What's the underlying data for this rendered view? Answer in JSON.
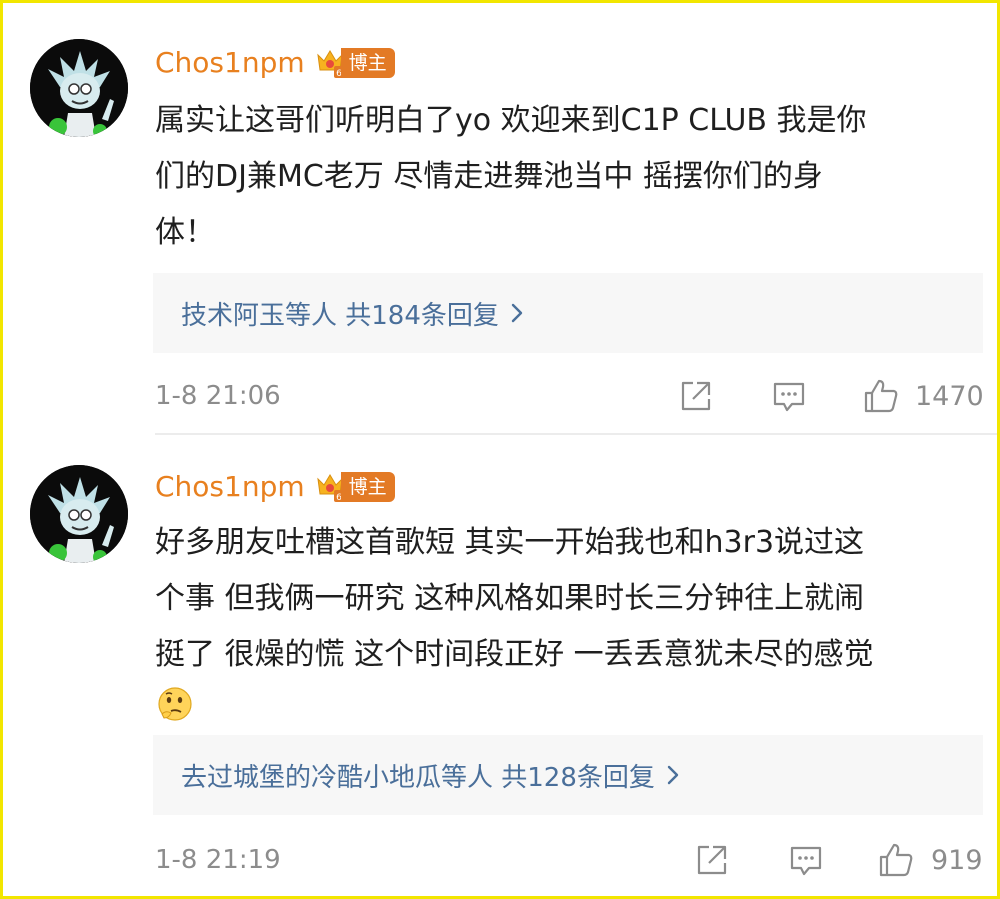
{
  "comments": [
    {
      "username": "Chos1npm",
      "badge_label": "博主",
      "text": "属实让这哥们听明白了yo 欢迎来到C1P CLUB 我是你\n们的DJ兼MC老万 尽情走进舞池当中 摇摆你们的身\n体！",
      "replies_text": "技术阿玉等人  共184条回复",
      "time": "1-8 21:06",
      "likes": "1470",
      "icons": [
        "share-icon",
        "comment-icon",
        "like-icon"
      ]
    },
    {
      "username": "Chos1npm",
      "badge_label": "博主",
      "text": "好多朋友吐槽这首歌短 其实一开始我也和h3r3说过这\n个事 但我俩一研究 这种风格如果时长三分钟往上就闹\n挺了 很燥的慌 这个时间段正好 一丢丢意犹未尽的感觉",
      "emoji": "thinking-emoji",
      "replies_text": "去过城堡的冷酷小地瓜等人  共128条回复",
      "time": "1-8 21:19",
      "likes": "919",
      "icons": [
        "share-icon",
        "comment-icon",
        "like-icon"
      ]
    }
  ],
  "colors": {
    "username": "#e8801f",
    "badge": "#e37a25",
    "replies_link": "#4a6f9a",
    "meta_gray": "#8c8c8c",
    "frame_border": "#f2e600"
  }
}
